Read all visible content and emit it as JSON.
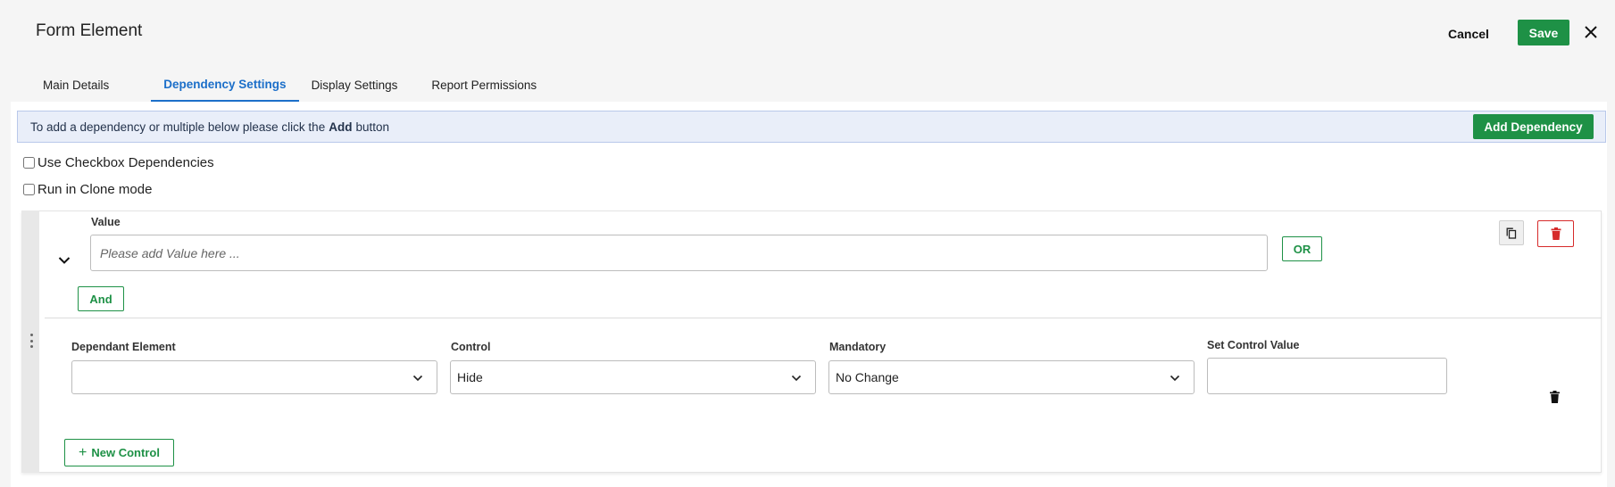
{
  "header": {
    "title": "Form Element",
    "cancel_label": "Cancel",
    "save_label": "Save",
    "close_icon": "close-icon"
  },
  "tabs": [
    {
      "label": "Main Details",
      "active": false
    },
    {
      "label": "Dependency Settings",
      "active": true
    },
    {
      "label": "Display Settings",
      "active": false
    },
    {
      "label": "Report Permissions",
      "active": false
    }
  ],
  "info_bar": {
    "text_before": "To add a dependency or multiple below please click the",
    "bold_word": "Add",
    "text_after": "button",
    "add_dependency_label": "Add Dependency"
  },
  "options": {
    "checkbox_dependencies_label": "Use Checkbox Dependencies",
    "checkbox_dependencies_checked": false,
    "clone_mode_label": "Run in Clone mode",
    "clone_mode_checked": false
  },
  "dependency": {
    "value_label": "Value",
    "value_placeholder": "Please add Value here ...",
    "value": "",
    "or_label": "OR",
    "and_label": "And",
    "controls": {
      "dependant_element_label": "Dependant Element",
      "dependant_element_value": "",
      "control_label": "Control",
      "control_value": "Hide",
      "mandatory_label": "Mandatory",
      "mandatory_value": "No Change",
      "set_control_value_label": "Set Control Value",
      "set_control_value": ""
    },
    "new_control_label": "New Control"
  },
  "colors": {
    "accent_green": "#1e9146",
    "tab_active_blue": "#1c6fc9",
    "danger_red": "#d62a2a",
    "info_bg": "#e9eef9"
  }
}
